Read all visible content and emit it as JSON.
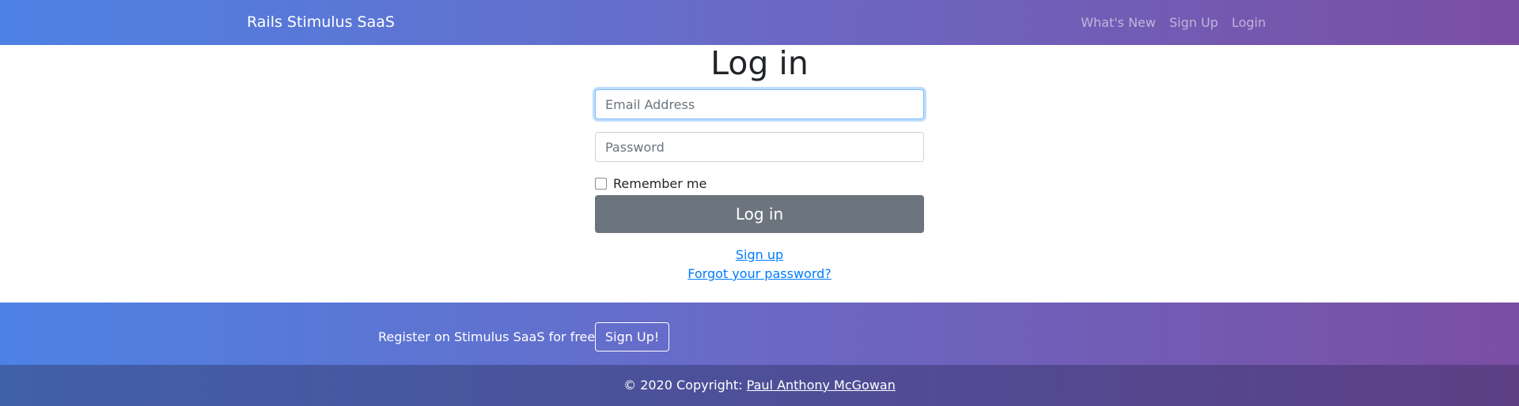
{
  "navbar": {
    "brand": "Rails Stimulus SaaS",
    "links": [
      "What's New",
      "Sign Up",
      "Login"
    ]
  },
  "login_form": {
    "title": "Log in",
    "email_placeholder": "Email Address",
    "email_value": "",
    "password_placeholder": "Password",
    "password_value": "",
    "remember_label": "Remember me",
    "remember_checked": false,
    "submit_label": "Log in",
    "signup_link": "Sign up",
    "forgot_link": "Forgot your password?"
  },
  "cta": {
    "text": "Register on Stimulus SaaS for free",
    "button_label": "Sign Up!"
  },
  "footer": {
    "copyright": "© 2020 Copyright:",
    "author_link": "Paul Anthony McGowan"
  },
  "colors": {
    "gradient_start": "#4d82e4",
    "gradient_end": "#7a4ea3",
    "button_secondary": "#6c757d",
    "link": "#007bff"
  }
}
